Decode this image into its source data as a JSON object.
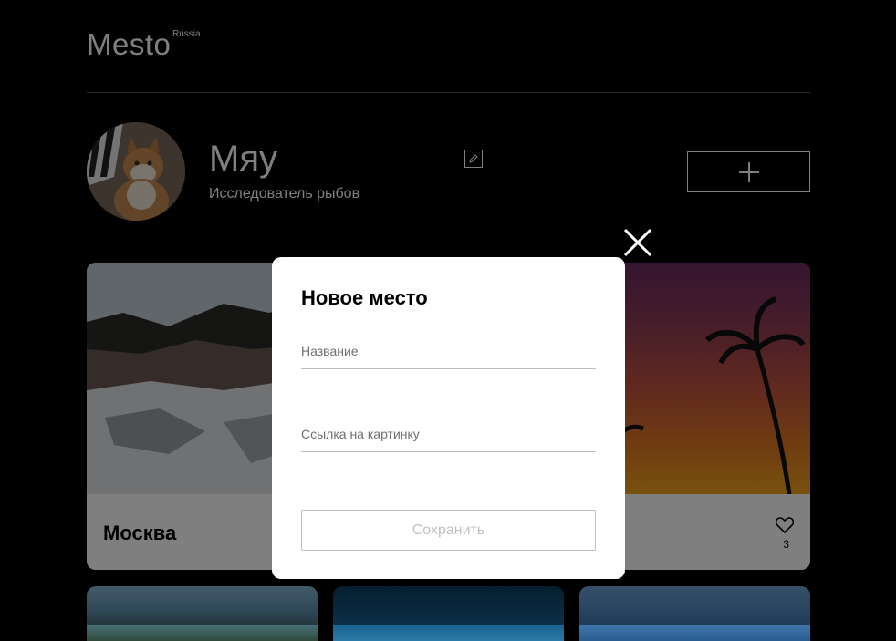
{
  "header": {
    "logo": "Mesto",
    "logo_sup": "Russia"
  },
  "profile": {
    "name": "Мяу",
    "about": "Исследователь рыбов"
  },
  "icons": {
    "edit": "pencil-icon",
    "add": "plus-icon",
    "close": "close-icon",
    "like": "heart-icon"
  },
  "cards": [
    {
      "title": "Москва"
    },
    {
      "likes": "3"
    }
  ],
  "popup": {
    "title": "Новое место",
    "name_placeholder": "Название",
    "link_placeholder": "Ссылка на картинку",
    "save_label": "Сохранить"
  }
}
